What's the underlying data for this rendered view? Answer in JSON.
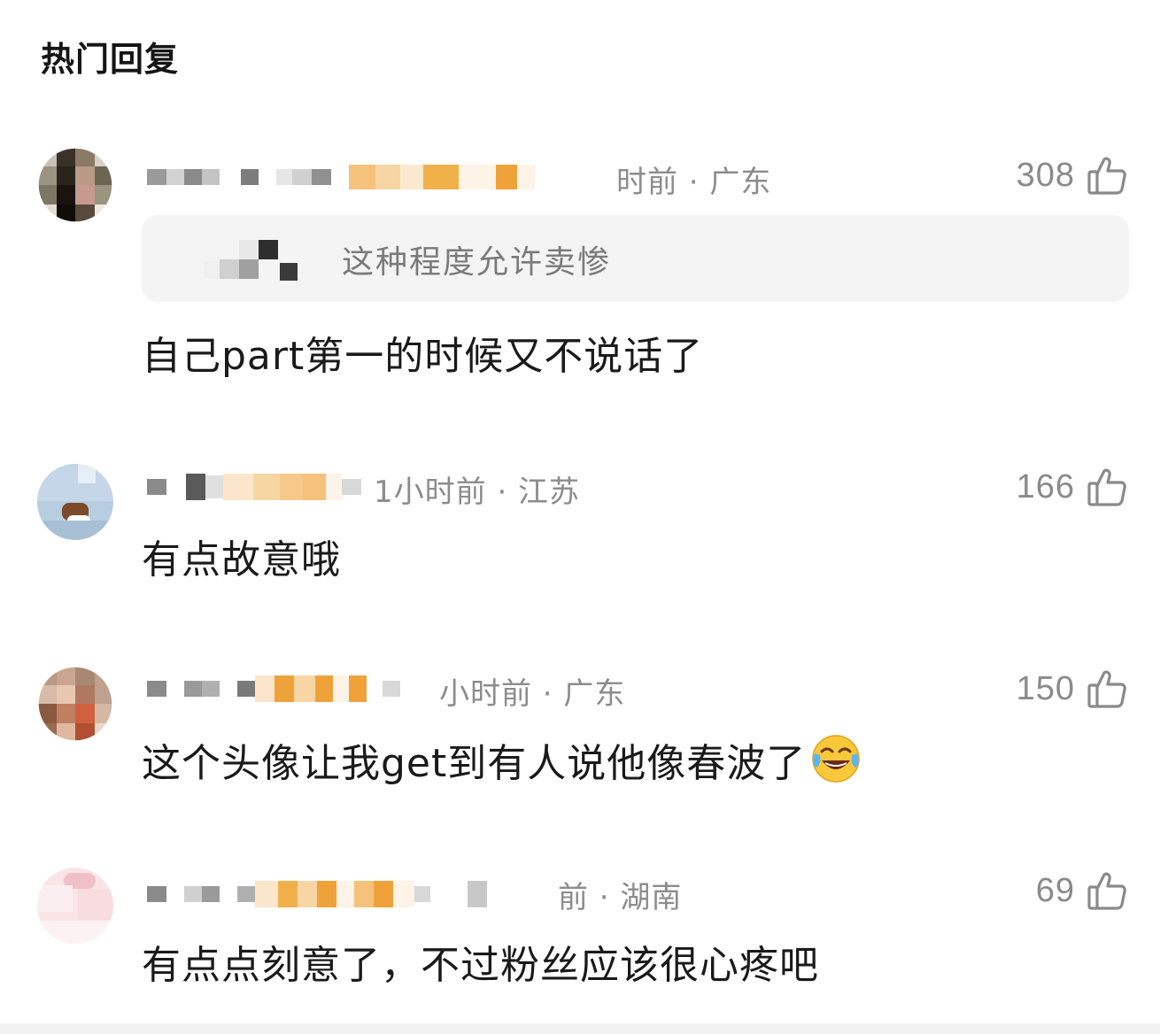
{
  "section_title": "热门回复",
  "comments": [
    {
      "meta": "时前 · 广东",
      "likes": "308",
      "quote": {
        "text": "这种程度允许卖惨"
      },
      "text": "自己part第一的时候又不说话了"
    },
    {
      "meta": "1小时前 · 江苏",
      "likes": "166",
      "text": "有点故意哦"
    },
    {
      "meta": "小时前 · 广东",
      "likes": "150",
      "text": "这个头像让我get到有人说他像春波了",
      "emoji": "tears-of-joy-emoji"
    },
    {
      "meta": "前 · 湖南",
      "likes": "69",
      "text": "有点点刻意了，不过粉丝应该很心疼吧"
    }
  ],
  "icons": {
    "like": "thumbs-up-icon"
  },
  "colors": {
    "meta_gray": "#8c8c8c",
    "quote_bg": "#f4f4f4",
    "name_orange": "#f0b04a"
  }
}
